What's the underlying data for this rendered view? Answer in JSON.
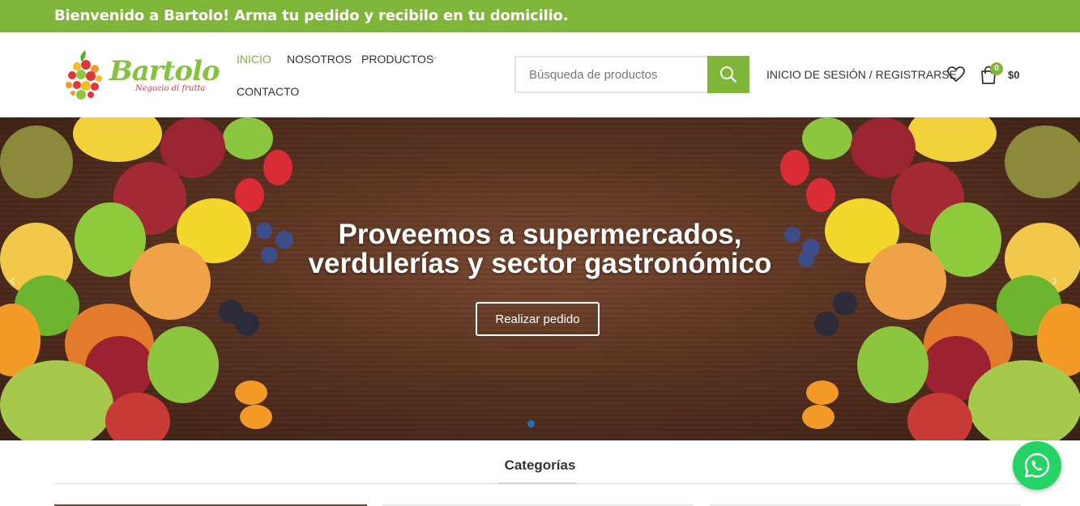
{
  "topbar": {
    "text": "Bienvenido a Bartolo!  Arma tu pedido y recibilo en tu domicilio."
  },
  "logo": {
    "wordmark": "Bartolo",
    "tagline": "Negozio di frutta"
  },
  "nav": {
    "items": [
      {
        "label": "INICIO",
        "active": true
      },
      {
        "label": "NOSOTROS",
        "active": false
      },
      {
        "label": "PRODUCTOS",
        "active": false
      },
      {
        "label": "CONTACTO",
        "active": false
      }
    ]
  },
  "search": {
    "placeholder": "Búsqueda de productos",
    "value": ""
  },
  "account": {
    "login_label": "INICIO DE SESIÓN / REGISTRARSE"
  },
  "cart": {
    "count": "0",
    "total": "$0"
  },
  "hero": {
    "title_line1": "Proveemos a supermercados,",
    "title_line2": "verdulerías y sector gastronómico",
    "button_label": "Realizar pedido",
    "prev_arrow": "‹",
    "next_arrow": "›"
  },
  "categories": {
    "title": "Categorías"
  },
  "colors": {
    "brand_green": "#7fb539",
    "slider_dot": "#1e73be",
    "whatsapp": "#25d366"
  },
  "icons": [
    "search-icon",
    "heart-icon",
    "cart-icon",
    "chevron-down-icon",
    "whatsapp-icon"
  ]
}
